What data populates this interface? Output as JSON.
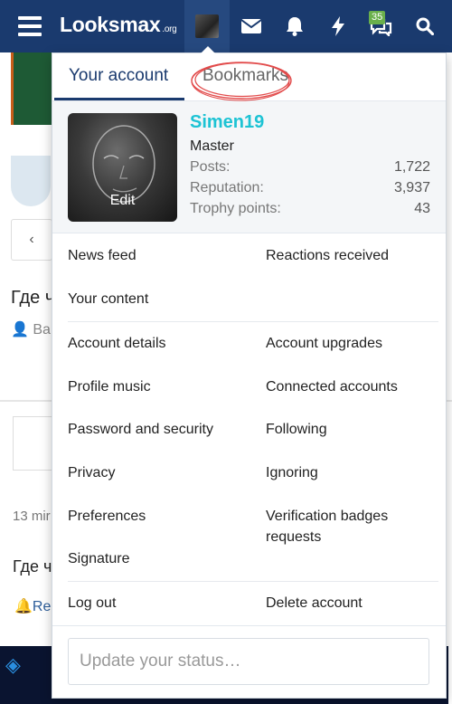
{
  "navbar": {
    "logo_main": "Looksmax",
    "logo_tld": ".org",
    "alerts_badge": "35",
    "icons": [
      "menu-icon",
      "avatar",
      "mail-icon",
      "bell-icon",
      "bolt-icon",
      "chat-icon",
      "search-icon"
    ]
  },
  "background": {
    "prev_arrow": "‹",
    "title_start": "Где ч",
    "author_start": "Bau",
    "time_start": "13 mir",
    "title2_start": "Где ч",
    "reply_start": "Rep"
  },
  "menu": {
    "tabs": [
      "Your account",
      "Bookmarks"
    ],
    "profile": {
      "username": "Simen19",
      "user_title": "Master",
      "avatar_edit": "Edit",
      "stats": [
        {
          "label": "Posts:",
          "value": "1,722"
        },
        {
          "label": "Reputation:",
          "value": "3,937"
        },
        {
          "label": "Trophy points:",
          "value": "43"
        }
      ]
    },
    "items": {
      "news_feed": "News feed",
      "reactions_received": "Reactions received",
      "your_content": "Your content",
      "account_details": "Account details",
      "account_upgrades": "Account upgrades",
      "profile_music": "Profile music",
      "connected_accounts": "Connected accounts",
      "password_security": "Password and security",
      "following": "Following",
      "privacy": "Privacy",
      "ignoring": "Ignoring",
      "preferences": "Preferences",
      "verification_badges": "Verification badges requests",
      "signature": "Signature",
      "log_out": "Log out",
      "delete_account": "Delete account"
    },
    "status_placeholder": "Update your status…"
  },
  "colors": {
    "navbar": "#1a3a6e",
    "username": "#1dc3d4",
    "badge": "#6ab04c",
    "annotation_circle": "#e24b4b"
  }
}
